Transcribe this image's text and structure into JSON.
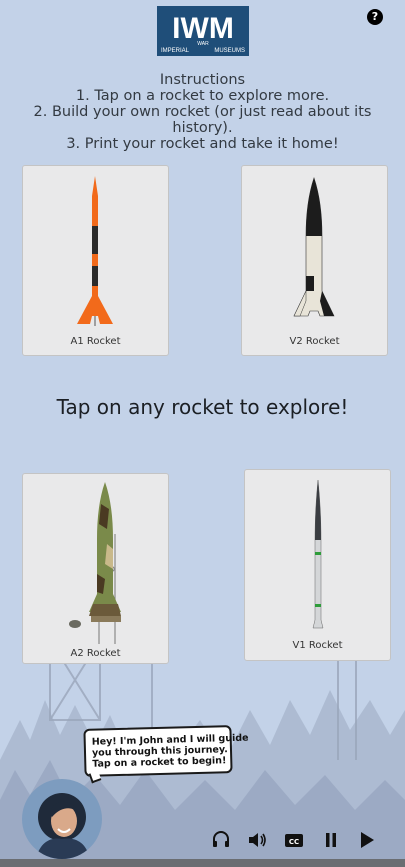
{
  "logo": {
    "initials": "IWM",
    "line_left": "IMPERIAL",
    "line_mid": "WAR",
    "line_right": "MUSEUMS"
  },
  "help_button": {
    "label": "?"
  },
  "instructions": {
    "heading": "Instructions",
    "steps": [
      "1. Tap on a rocket to explore more.",
      "2. Build your own rocket (or just read about its",
      "history).",
      "3. Print your rocket and take it home!"
    ]
  },
  "rockets": [
    {
      "label": "A1 Rocket"
    },
    {
      "label": "V2 Rocket"
    },
    {
      "label": "A2 Rocket"
    },
    {
      "label": "V1 Rocket"
    }
  ],
  "tagline": "Tap on any rocket to explore!",
  "guide": {
    "lines": [
      "Hey! I'm John and I will guide",
      "you through this journey.",
      "Tap on a rocket to begin!"
    ]
  },
  "controls": [
    {
      "icon": "headphones-icon"
    },
    {
      "icon": "volume-icon"
    },
    {
      "icon": "closed-captions-icon",
      "label": "CC"
    },
    {
      "icon": "pause-icon"
    },
    {
      "icon": "play-icon"
    }
  ],
  "colors": {
    "background": "#c3d2e8",
    "logo_blue": "#1f4e79",
    "card": "#e9e9ea",
    "a1_orange": "#f26a1b"
  }
}
